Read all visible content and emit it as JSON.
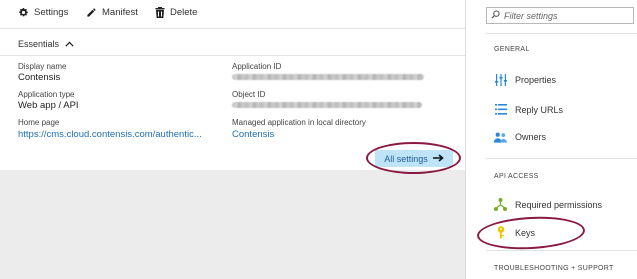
{
  "toolbar": {
    "settings_label": "Settings",
    "manifest_label": "Manifest",
    "delete_label": "Delete"
  },
  "essentials": {
    "label": "Essentials",
    "fields": {
      "display_name_label": "Display name",
      "display_name_value": "Contensis",
      "application_type_label": "Application type",
      "application_type_value": "Web app / API",
      "home_page_label": "Home page",
      "home_page_value": "https://cms.cloud.contensis.com/authentic...",
      "application_id_label": "Application ID",
      "object_id_label": "Object ID",
      "managed_app_label": "Managed application in local directory",
      "managed_app_value": "Contensis"
    },
    "all_settings_label": "All settings"
  },
  "sidebar": {
    "filter_placeholder": "Filter settings",
    "sections": {
      "general": "GENERAL",
      "api_access": "API ACCESS",
      "troubleshooting": "TROUBLESHOOTING + SUPPORT"
    },
    "items": {
      "properties": "Properties",
      "reply_urls": "Reply URLs",
      "owners": "Owners",
      "required_permissions": "Required permissions",
      "keys": "Keys"
    }
  },
  "colors": {
    "link": "#1e6fb5",
    "highlight_button": "#bfe3f7",
    "annotation_ellipse": "#8a1a43",
    "key_icon": "#f2c400",
    "permissions_icon": "#7cab2f",
    "owners_icon": "#2b88d8"
  },
  "icons": [
    "gear-icon",
    "pencil-icon",
    "trash-icon",
    "chevron-up-icon",
    "arrow-right-icon",
    "search-icon",
    "properties-icon",
    "list-icon",
    "owners-icon",
    "permissions-icon",
    "key-icon"
  ]
}
